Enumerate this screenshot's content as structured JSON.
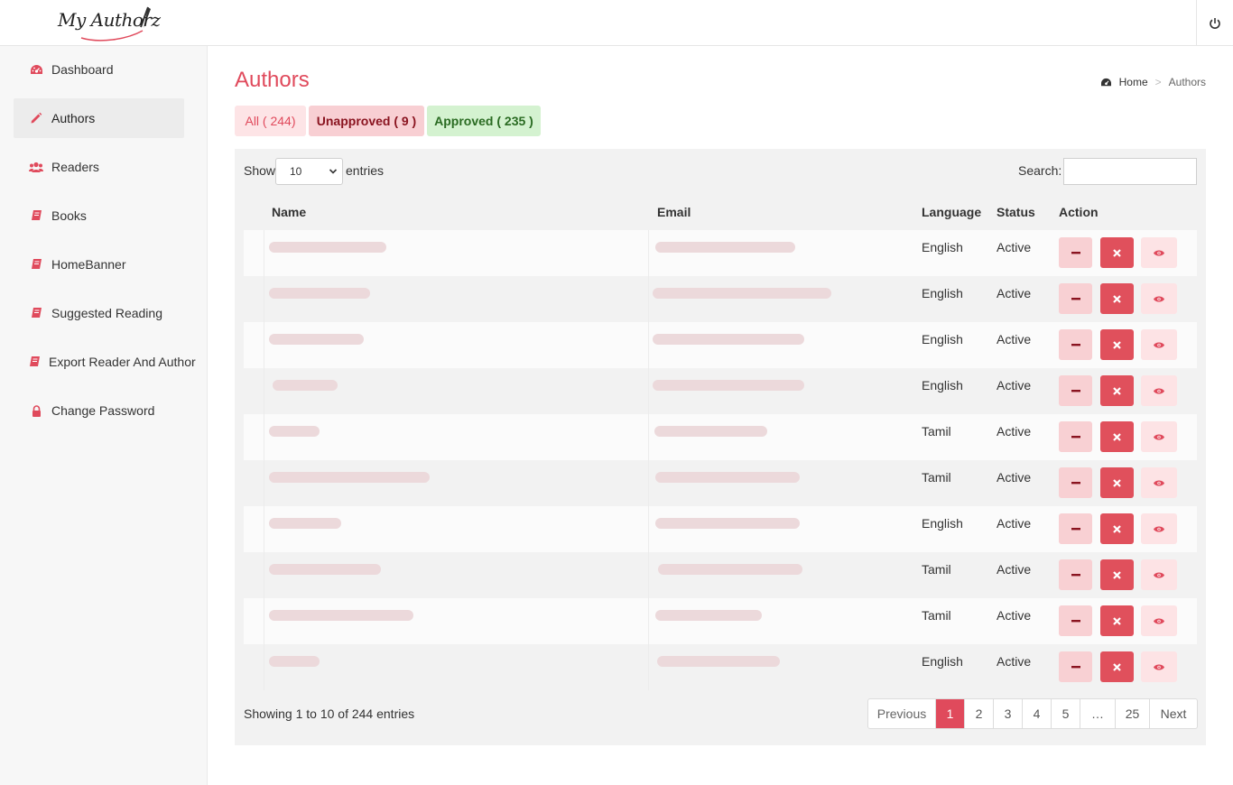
{
  "app": {
    "logo_text": "My Authorz"
  },
  "sidebar": {
    "items": [
      {
        "label": "Dashboard",
        "icon": "dashboard-icon"
      },
      {
        "label": "Authors",
        "icon": "pencil-icon"
      },
      {
        "label": "Readers",
        "icon": "users-icon"
      },
      {
        "label": "Books",
        "icon": "book-icon"
      },
      {
        "label": "HomeBanner",
        "icon": "book-icon"
      },
      {
        "label": "Suggested Reading",
        "icon": "book-icon"
      },
      {
        "label": "Export Reader And Author",
        "icon": "book-icon"
      },
      {
        "label": "Change Password",
        "icon": "lock-icon"
      }
    ]
  },
  "page": {
    "title": "Authors",
    "breadcrumb": {
      "home": "Home",
      "current": "Authors"
    }
  },
  "filters": {
    "all": "All ( 244)",
    "unapproved": "Unapproved ( 9 )",
    "approved": "Approved ( 235 )"
  },
  "table_controls": {
    "show_label": "Show",
    "page_size": "10",
    "entries_label": "entries",
    "search_label": "Search:",
    "search_value": ""
  },
  "columns": {
    "name": "Name",
    "email": "Email",
    "language": "Language",
    "status": "Status",
    "action": "Action"
  },
  "rows": [
    {
      "language": "English",
      "status": "Active"
    },
    {
      "language": "English",
      "status": "Active"
    },
    {
      "language": "English",
      "status": "Active"
    },
    {
      "language": "English",
      "status": "Active"
    },
    {
      "language": "Tamil",
      "status": "Active"
    },
    {
      "language": "Tamil",
      "status": "Active"
    },
    {
      "language": "English",
      "status": "Active"
    },
    {
      "language": "Tamil",
      "status": "Active"
    },
    {
      "language": "Tamil",
      "status": "Active"
    },
    {
      "language": "English",
      "status": "Active"
    }
  ],
  "footer": {
    "info": "Showing 1 to 10 of 244 entries",
    "pagination": {
      "previous": "Previous",
      "pages": [
        "1",
        "2",
        "3",
        "4",
        "5",
        "…",
        "25"
      ],
      "next": "Next",
      "current": "1"
    }
  },
  "colors": {
    "accent": "#e04a5c",
    "approved_bg": "#d4f2d0",
    "unapproved_bg": "#f8cfd3"
  }
}
